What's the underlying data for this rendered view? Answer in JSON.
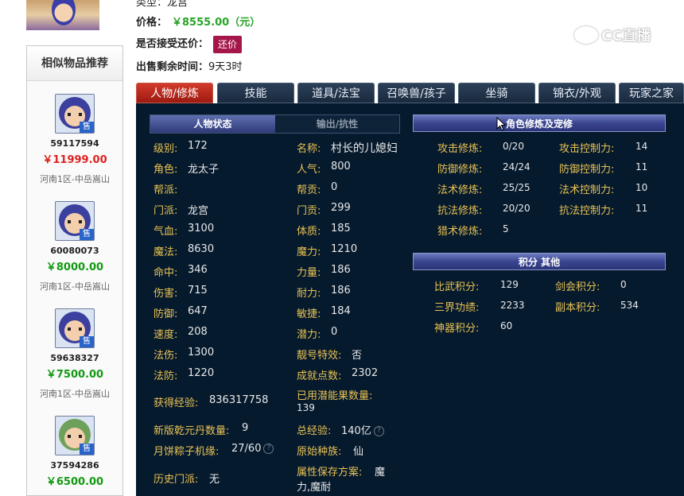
{
  "header": {
    "type_partial": "类型：龙宫",
    "price_label": "价格：",
    "price_value": "￥8555.00（元）",
    "bargain_label": "是否接受还价：",
    "bargain_button": "还价",
    "remain_label": "出售剩余时间：",
    "remain_value": "9天3时"
  },
  "watermark": "CC直播",
  "sidebar": {
    "title": "相似物品推荐",
    "items": [
      {
        "id": "59117594",
        "price": "￥11999.00",
        "server": "河南1区-中岳嵩山",
        "sold": "售"
      },
      {
        "id": "60080073",
        "price": "￥8000.00",
        "server": "河南1区-中岳嵩山",
        "sold": "售"
      },
      {
        "id": "59638327",
        "price": "￥7500.00",
        "server": "河南1区-中岳嵩山",
        "sold": "售"
      },
      {
        "id": "37594286",
        "price": "￥6500.00",
        "server": "",
        "sold": "售"
      }
    ]
  },
  "tabs": [
    "人物/修炼",
    "技能",
    "道具/法宝",
    "召唤兽/孩子",
    "坐骑",
    "锦衣/外观",
    "玩家之家"
  ],
  "subtabs": [
    "人物状态",
    "输出/抗性"
  ],
  "bars": {
    "cultivation": "角色修炼及宠修",
    "score": "积分 其他"
  },
  "stats": {
    "level_l": "级别:",
    "level_v": "172",
    "name_l": "名称:",
    "name_v": "村长的儿媳妇",
    "role_l": "角色:",
    "role_v": "龙太子",
    "pop_l": "人气:",
    "pop_v": "800",
    "gang_l": "帮派:",
    "gang_v": "",
    "gangc_l": "帮贡:",
    "gangc_v": "0",
    "sect_l": "门派:",
    "sect_v": "龙宫",
    "sectc_l": "门贡:",
    "sectc_v": "299",
    "hp_l": "气血:",
    "hp_v": "3100",
    "con_l": "体质:",
    "con_v": "185",
    "mp_l": "魔法:",
    "mp_v": "8630",
    "mag_l": "魔力:",
    "mag_v": "1210",
    "hit_l": "命中:",
    "hit_v": "346",
    "str_l": "力量:",
    "str_v": "186",
    "dmg_l": "伤害:",
    "dmg_v": "715",
    "end_l": "耐力:",
    "end_v": "186",
    "def_l": "防御:",
    "def_v": "647",
    "agi_l": "敏捷:",
    "agi_v": "184",
    "spd_l": "速度:",
    "spd_v": "208",
    "pot_l": "潜力:",
    "pot_v": "0",
    "matk_l": "法伤:",
    "matk_v": "1300",
    "num_l": "靓号特效:",
    "num_v": "否",
    "mdef_l": "法防:",
    "mdef_v": "1220",
    "ach_l": "成就点数:",
    "ach_v": "2302",
    "exp_l": "获得经验:",
    "exp_v": "836317758",
    "fruit_l": "已用潜能果数量:",
    "fruit_v": "139",
    "qyd_l": "新版乾元丹数量:",
    "qyd_v": "9",
    "totexp_l": "总经验:",
    "totexp_v": "140亿",
    "moon_l": "月饼粽子机缘:",
    "moon_v": "27/60",
    "race_l": "原始种族:",
    "race_v": "仙",
    "hist_l": "历史门派:",
    "hist_v": "无",
    "save_l": "属性保存方案:",
    "save_v1": "魔",
    "save_v2": "力,魔耐"
  },
  "cultivation": {
    "atk_l": "攻击修炼:",
    "atk_v": "0/20",
    "atkc_l": "攻击控制力:",
    "atkc_v": "14",
    "def_l": "防御修炼:",
    "def_v": "24/24",
    "defc_l": "防御控制力:",
    "defc_v": "11",
    "mag_l": "法术修炼:",
    "mag_v": "25/25",
    "magc_l": "法术控制力:",
    "magc_v": "10",
    "res_l": "抗法修炼:",
    "res_v": "20/20",
    "resc_l": "抗法控制力:",
    "resc_v": "11",
    "hunt_l": "猎术修炼:",
    "hunt_v": "5"
  },
  "score": {
    "pvp_l": "比武积分:",
    "pvp_v": "129",
    "sword_l": "剑会积分:",
    "sword_v": "0",
    "merit_l": "三界功绩:",
    "merit_v": "2233",
    "dungeon_l": "副本积分:",
    "dungeon_v": "534",
    "artifact_l": "神器积分:",
    "artifact_v": "60"
  },
  "colors": {
    "label": "#e8c252",
    "value": "#e8e8e8",
    "panel": "#061a2e",
    "active_tab": "#c02a1e",
    "price_green": "#27a427",
    "price_red": "#e02020"
  }
}
